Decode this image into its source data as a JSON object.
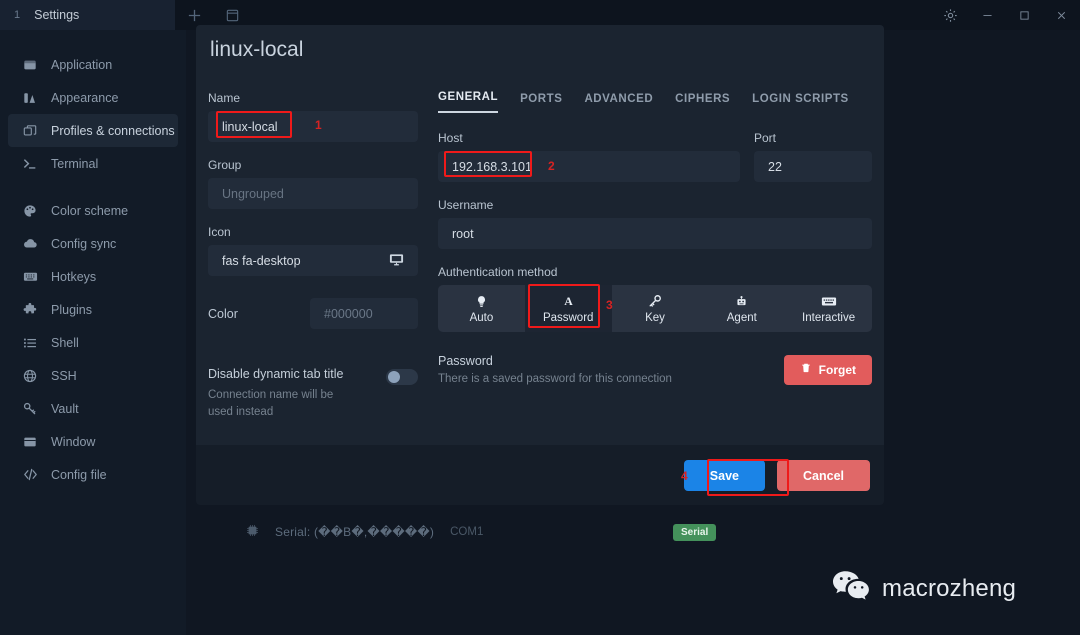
{
  "titlebar": {
    "tab_index": "1",
    "tab_title": "Settings",
    "new_tab_icon": "plus-icon",
    "split_icon": "window-icon",
    "settings_icon": "gear-icon",
    "minimize_icon": "minimize-icon",
    "maximize_icon": "maximize-icon",
    "close_icon": "close-icon"
  },
  "sidebar": {
    "items": [
      {
        "label": "Application",
        "icon": "application-icon",
        "active": false
      },
      {
        "label": "Appearance",
        "icon": "appearance-icon",
        "active": false
      },
      {
        "label": "Profiles & connections",
        "icon": "profiles-icon",
        "active": true
      },
      {
        "label": "Terminal",
        "icon": "terminal-icon",
        "active": false
      },
      {
        "label": "Color scheme",
        "icon": "palette-icon",
        "active": false
      },
      {
        "label": "Config sync",
        "icon": "cloud-icon",
        "active": false
      },
      {
        "label": "Hotkeys",
        "icon": "keyboard-icon",
        "active": false
      },
      {
        "label": "Plugins",
        "icon": "puzzle-icon",
        "active": false
      },
      {
        "label": "Shell",
        "icon": "list-icon",
        "active": false
      },
      {
        "label": "SSH",
        "icon": "globe-icon",
        "active": false
      },
      {
        "label": "Vault",
        "icon": "key-icon",
        "active": false
      },
      {
        "label": "Window",
        "icon": "window-icon",
        "active": false
      },
      {
        "label": "Config file",
        "icon": "code-icon",
        "active": false
      }
    ]
  },
  "statusbar": {
    "icon": "chip-icon",
    "text": "Serial: (��B�,�����)",
    "port": "COM1",
    "badge": "Serial",
    "badge_color": "#44915b"
  },
  "watermark": {
    "icon": "wechat-icon",
    "text": "macrozheng"
  },
  "modal": {
    "title": "linux-local",
    "left": {
      "name_label": "Name",
      "name_value": "linux-local",
      "group_label": "Group",
      "group_placeholder": "Ungrouped",
      "icon_label": "Icon",
      "icon_value": "fas fa-desktop",
      "icon_preview": "monitor-icon",
      "color_label": "Color",
      "color_placeholder": "#000000",
      "toggle_title": "Disable dynamic tab title",
      "toggle_sub": "Connection name will be used instead",
      "toggle_on": false
    },
    "tabs": [
      {
        "label": "GENERAL",
        "selected": true
      },
      {
        "label": "PORTS",
        "selected": false
      },
      {
        "label": "ADVANCED",
        "selected": false
      },
      {
        "label": "CIPHERS",
        "selected": false
      },
      {
        "label": "LOGIN SCRIPTS",
        "selected": false
      }
    ],
    "general": {
      "host_label": "Host",
      "host_value": "192.168.3.101",
      "port_label": "Port",
      "port_value": "22",
      "username_label": "Username",
      "username_value": "root",
      "auth_label": "Authentication method",
      "auth_methods": [
        {
          "label": "Auto",
          "icon": "bulb-icon",
          "selected": false
        },
        {
          "label": "Password",
          "icon": "letter-a-icon",
          "selected": true
        },
        {
          "label": "Key",
          "icon": "key-icon",
          "selected": false
        },
        {
          "label": "Agent",
          "icon": "robot-icon",
          "selected": false
        },
        {
          "label": "Interactive",
          "icon": "keyboard-icon",
          "selected": false
        }
      ],
      "password_label": "Password",
      "password_sub": "There is a saved password for this connection",
      "forget_label": "Forget",
      "forget_icon": "trash-icon",
      "forget_color": "#e25c5c"
    },
    "footer": {
      "save_label": "Save",
      "save_color": "#1b84e7",
      "cancel_label": "Cancel",
      "cancel_color": "#e06868"
    }
  },
  "annotations": {
    "color": "#ef1a1a",
    "marks": [
      {
        "num": "1",
        "target": "name-field"
      },
      {
        "num": "2",
        "target": "host-field"
      },
      {
        "num": "3",
        "target": "auth-password"
      },
      {
        "num": "4",
        "target": "save-button"
      }
    ]
  }
}
